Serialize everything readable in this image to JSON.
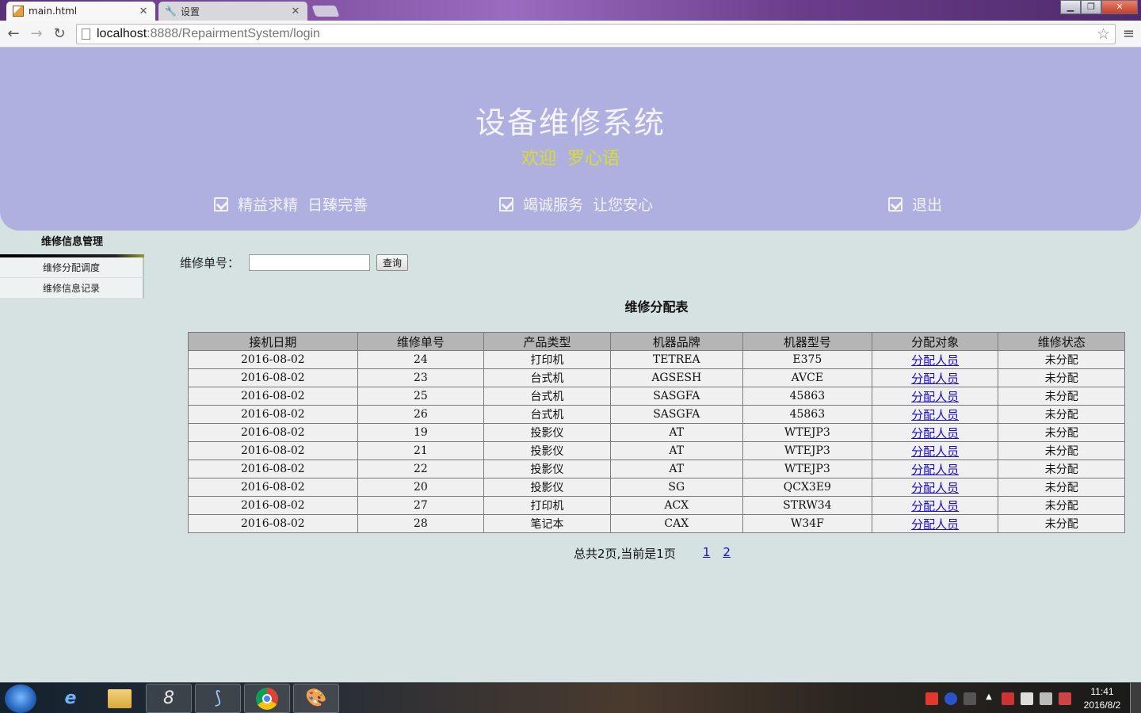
{
  "browser": {
    "tabs": [
      {
        "title": "main.html",
        "active": true
      },
      {
        "title": "设置",
        "active": false
      }
    ],
    "url_host": "localhost",
    "url_path": ":8888/RepairmentSystem/login"
  },
  "header": {
    "title": "设备维修系统",
    "welcome": "欢迎  罗心语",
    "links": [
      "精益求精  日臻完善",
      "竭诚服务  让您安心",
      "退出"
    ]
  },
  "sidebar": {
    "heading": "维修信息管理",
    "items": [
      "维修分配调度",
      "维修信息记录"
    ]
  },
  "search": {
    "label": "维修单号：",
    "value": "",
    "button": "查询"
  },
  "table": {
    "caption": "维修分配表",
    "columns": [
      "接机日期",
      "维修单号",
      "产品类型",
      "机器品牌",
      "机器型号",
      "分配对象",
      "维修状态"
    ],
    "rows": [
      [
        "2016-08-02",
        "24",
        "打印机",
        "TETREA",
        "E375",
        "分配人员",
        "未分配"
      ],
      [
        "2016-08-02",
        "23",
        "台式机",
        "AGSESH",
        "AVCE",
        "分配人员",
        "未分配"
      ],
      [
        "2016-08-02",
        "25",
        "台式机",
        "SASGFA",
        "45863",
        "分配人员",
        "未分配"
      ],
      [
        "2016-08-02",
        "26",
        "台式机",
        "SASGFA",
        "45863",
        "分配人员",
        "未分配"
      ],
      [
        "2016-08-02",
        "19",
        "投影仪",
        "AT",
        "WTEJP3",
        "分配人员",
        "未分配"
      ],
      [
        "2016-08-02",
        "21",
        "投影仪",
        "AT",
        "WTEJP3",
        "分配人员",
        "未分配"
      ],
      [
        "2016-08-02",
        "22",
        "投影仪",
        "AT",
        "WTEJP3",
        "分配人员",
        "未分配"
      ],
      [
        "2016-08-02",
        "20",
        "投影仪",
        "SG",
        "QCX3E9",
        "分配人员",
        "未分配"
      ],
      [
        "2016-08-02",
        "27",
        "打印机",
        "ACX",
        "STRW34",
        "分配人员",
        "未分配"
      ],
      [
        "2016-08-02",
        "28",
        "笔记本",
        "CAX",
        "W34F",
        "分配人员",
        "未分配"
      ]
    ]
  },
  "pager": {
    "summary": "总共2页,当前是1页",
    "pages": [
      "1",
      "2"
    ]
  },
  "taskbar": {
    "time": "11:41",
    "date": "2016/8/2"
  },
  "colors": {
    "banner": "#b0b0e0",
    "welcome": "#d8dc30",
    "link": "#1a0dcc",
    "page_bg": "#d5e2e1"
  }
}
